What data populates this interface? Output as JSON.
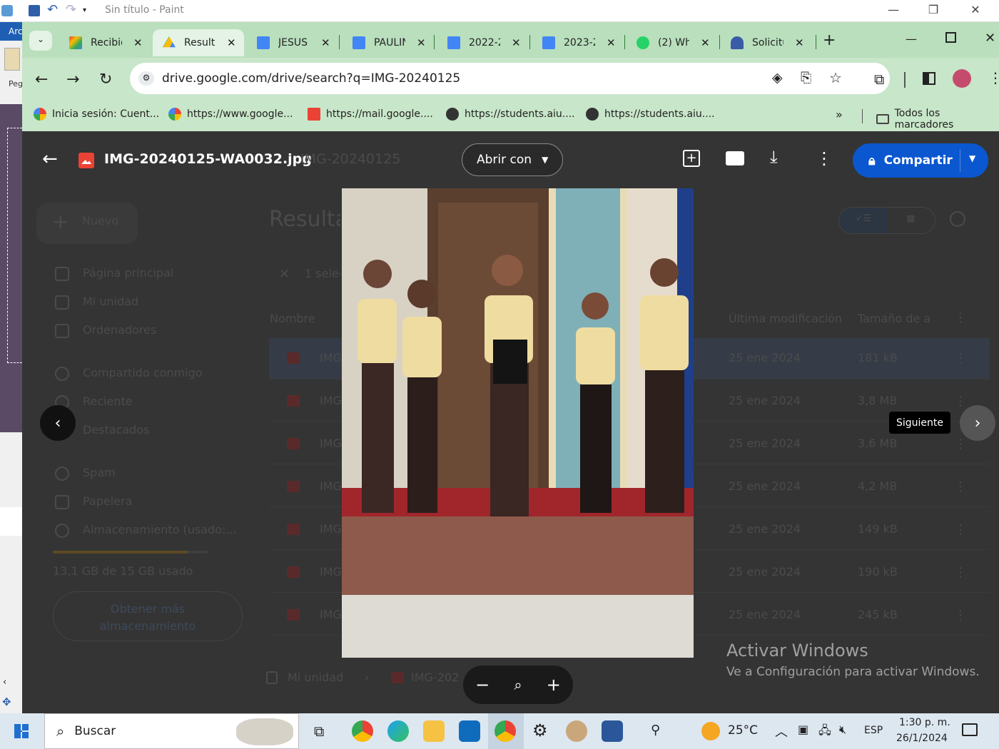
{
  "paint": {
    "title": "Sin título - Paint",
    "left_label": "Arc",
    "left_label2": "Peg"
  },
  "tabs": [
    {
      "label": "Recibid",
      "icon": "gmail-icon"
    },
    {
      "label": "Resulta",
      "icon": "drive-icon",
      "active": true
    },
    {
      "label": "JESUS",
      "icon": "docs-icon"
    },
    {
      "label": "PAULIN",
      "icon": "docs-icon"
    },
    {
      "label": "2022-2",
      "icon": "docs-icon"
    },
    {
      "label": "2023-2",
      "icon": "docs-icon"
    },
    {
      "label": "(2) Wh",
      "icon": "whatsapp-icon"
    },
    {
      "label": "Solicitu",
      "icon": "bank-icon"
    }
  ],
  "omnibox": {
    "url": "drive.google.com/drive/search?q=IMG-20240125"
  },
  "bookmarks": [
    {
      "label": "Inicia sesión: Cuent...",
      "icon": "google-icon"
    },
    {
      "label": "https://www.google...",
      "icon": "google-icon"
    },
    {
      "label": "https://mail.google....",
      "icon": "gmail-icon"
    },
    {
      "label": "https://students.aiu....",
      "icon": "globe-icon"
    },
    {
      "label": "https://students.aiu....",
      "icon": "globe-icon"
    }
  ],
  "all_bookmarks": "Todos los marcadores",
  "viewer": {
    "file_name": "IMG-20240125-WA0032.jpg",
    "ghost_title": "IMG-20240125",
    "open_with": "Abrir con",
    "share": "Compartir",
    "tooltip_next": "Siguiente"
  },
  "drive_bg": {
    "new_label": "Nuevo",
    "results_title": "Resulta",
    "selected": "1 selec",
    "nav": [
      "Página principal",
      "Mi unidad",
      "Ordenadores",
      "Compartido conmigo",
      "Reciente",
      "Destacados",
      "Spam",
      "Papelera",
      "Almacenamiento (usado:..."
    ],
    "storage_text": "13,1 GB de 15 GB usado",
    "storage_fraction": 0.87,
    "get_more": "Obtener más almacenamiento",
    "col_name": "Nombre",
    "col_modified": "Última modificación",
    "col_size": "Tamaño de a",
    "rows": [
      {
        "name": "IMG",
        "date": "25 ene 2024",
        "size": "181 kB"
      },
      {
        "name": "IMG",
        "date": "25 ene 2024",
        "size": "3,8 MB"
      },
      {
        "name": "IMG",
        "date": "25 ene 2024",
        "size": "3,6 MB"
      },
      {
        "name": "IMG",
        "date": "25 ene 2024",
        "size": "4,2 MB"
      },
      {
        "name": "IMG",
        "date": "25 ene 2024",
        "size": "149 kB"
      },
      {
        "name": "IMG",
        "date": "25 ene 2024",
        "size": "190 kB"
      },
      {
        "name": "IMG",
        "date": "25 ene 2024",
        "size": "245 kB"
      }
    ],
    "breadcrumb_root": "Mi unidad",
    "breadcrumb_file": "IMG-202"
  },
  "activate_windows": {
    "title": "Activar Windows",
    "subtitle": "Ve a Configuración para activar Windows."
  },
  "taskbar": {
    "search_placeholder": "Buscar",
    "weather": "25°C",
    "lang": "ESP",
    "time": "1:30 p. m.",
    "date": "26/1/2024"
  }
}
